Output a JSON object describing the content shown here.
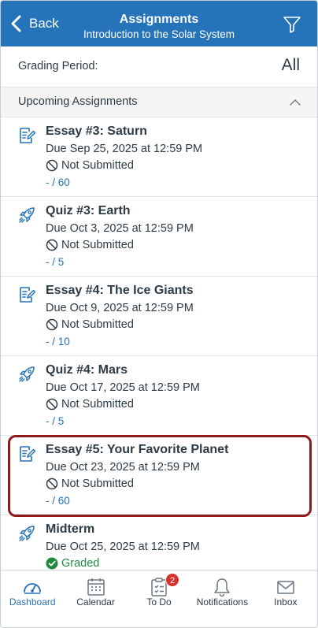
{
  "header": {
    "back_label": "Back",
    "title": "Assignments",
    "subtitle": "Introduction to the Solar System"
  },
  "grading_period": {
    "label": "Grading Period:",
    "value": "All"
  },
  "section": {
    "label": "Upcoming Assignments"
  },
  "assignments": [
    {
      "icon": "assignment-icon",
      "title": "Essay #3: Saturn",
      "due": "Due Sep 25, 2025 at 12:59 PM",
      "status": "Not Submitted",
      "score": "- / 60"
    },
    {
      "icon": "quiz-rocket-icon",
      "title": "Quiz #3: Earth",
      "due": "Due Oct 3, 2025 at 12:59 PM",
      "status": "Not Submitted",
      "score": "- / 5"
    },
    {
      "icon": "assignment-icon",
      "title": "Essay #4: The Ice Giants",
      "due": "Due Oct 9, 2025 at 12:59 PM",
      "status": "Not Submitted",
      "score": "- / 10"
    },
    {
      "icon": "quiz-rocket-icon",
      "title": "Quiz #4: Mars",
      "due": "Due Oct 17, 2025 at 12:59 PM",
      "status": "Not Submitted",
      "score": "- / 5"
    },
    {
      "icon": "assignment-icon",
      "title": "Essay #5: Your Favorite Planet",
      "due": "Due Oct 23, 2025 at 12:59 PM",
      "status": "Not Submitted",
      "score": "- / 60"
    },
    {
      "icon": "quiz-rocket-icon",
      "title": "Midterm",
      "due": "Due Oct 25, 2025 at 12:59 PM",
      "status": "Graded",
      "score": ""
    }
  ],
  "tabs": [
    {
      "label": "Dashboard",
      "icon": "dashboard-icon"
    },
    {
      "label": "Calendar",
      "icon": "calendar-icon"
    },
    {
      "label": "To Do",
      "icon": "todo-icon",
      "badge": "2"
    },
    {
      "label": "Notifications",
      "icon": "bell-icon"
    },
    {
      "label": "Inbox",
      "icon": "envelope-icon"
    }
  ],
  "colors": {
    "header": "#2573b8",
    "accent": "#2573b8",
    "highlight": "#8e1a1e",
    "graded": "#1f8a3d",
    "badge": "#d6312a"
  }
}
